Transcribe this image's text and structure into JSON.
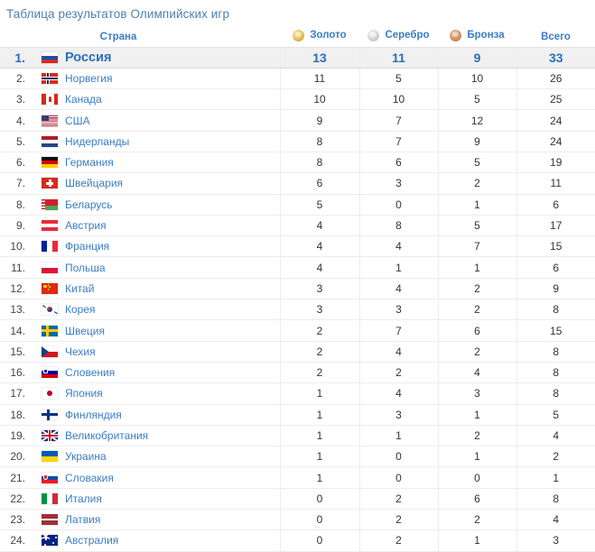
{
  "page": {
    "title": "Таблица результатов Олимпийских игр",
    "accent_color": "#3b7dc4",
    "leader_row_bg": "#f0f0f0"
  },
  "table": {
    "columns": {
      "rank": "",
      "country": "Страна",
      "gold": "Золото",
      "silver": "Серебро",
      "bronze": "Бронза",
      "total": "Всего"
    },
    "icons": {
      "gold": "gold-medal-icon",
      "silver": "silver-medal-icon",
      "bronze": "bronze-medal-icon"
    },
    "rows": [
      {
        "rank": "1.",
        "country": "Россия",
        "flag": "ru",
        "gold": "13",
        "silver": "11",
        "bronze": "9",
        "total": "33",
        "leader": true
      },
      {
        "rank": "2.",
        "country": "Норвегия",
        "flag": "no",
        "gold": "11",
        "silver": "5",
        "bronze": "10",
        "total": "26",
        "leader": false
      },
      {
        "rank": "3.",
        "country": "Канада",
        "flag": "ca",
        "gold": "10",
        "silver": "10",
        "bronze": "5",
        "total": "25",
        "leader": false
      },
      {
        "rank": "4.",
        "country": "США",
        "flag": "us",
        "gold": "9",
        "silver": "7",
        "bronze": "12",
        "total": "24",
        "leader": false
      },
      {
        "rank": "5.",
        "country": "Нидерланды",
        "flag": "nl",
        "gold": "8",
        "silver": "7",
        "bronze": "9",
        "total": "24",
        "leader": false
      },
      {
        "rank": "6.",
        "country": "Германия",
        "flag": "de",
        "gold": "8",
        "silver": "6",
        "bronze": "5",
        "total": "19",
        "leader": false
      },
      {
        "rank": "7.",
        "country": "Швейцария",
        "flag": "ch",
        "gold": "6",
        "silver": "3",
        "bronze": "2",
        "total": "11",
        "leader": false
      },
      {
        "rank": "8.",
        "country": "Беларусь",
        "flag": "by",
        "gold": "5",
        "silver": "0",
        "bronze": "1",
        "total": "6",
        "leader": false
      },
      {
        "rank": "9.",
        "country": "Австрия",
        "flag": "at",
        "gold": "4",
        "silver": "8",
        "bronze": "5",
        "total": "17",
        "leader": false
      },
      {
        "rank": "10.",
        "country": "Франция",
        "flag": "fr",
        "gold": "4",
        "silver": "4",
        "bronze": "7",
        "total": "15",
        "leader": false
      },
      {
        "rank": "11.",
        "country": "Польша",
        "flag": "pl",
        "gold": "4",
        "silver": "1",
        "bronze": "1",
        "total": "6",
        "leader": false
      },
      {
        "rank": "12.",
        "country": "Китай",
        "flag": "cn",
        "gold": "3",
        "silver": "4",
        "bronze": "2",
        "total": "9",
        "leader": false
      },
      {
        "rank": "13.",
        "country": "Корея",
        "flag": "kr",
        "gold": "3",
        "silver": "3",
        "bronze": "2",
        "total": "8",
        "leader": false
      },
      {
        "rank": "14.",
        "country": "Швеция",
        "flag": "se",
        "gold": "2",
        "silver": "7",
        "bronze": "6",
        "total": "15",
        "leader": false
      },
      {
        "rank": "15.",
        "country": "Чехия",
        "flag": "cz",
        "gold": "2",
        "silver": "4",
        "bronze": "2",
        "total": "8",
        "leader": false
      },
      {
        "rank": "16.",
        "country": "Словения",
        "flag": "si",
        "gold": "2",
        "silver": "2",
        "bronze": "4",
        "total": "8",
        "leader": false
      },
      {
        "rank": "17.",
        "country": "Япония",
        "flag": "jp",
        "gold": "1",
        "silver": "4",
        "bronze": "3",
        "total": "8",
        "leader": false
      },
      {
        "rank": "18.",
        "country": "Финляндия",
        "flag": "fi",
        "gold": "1",
        "silver": "3",
        "bronze": "1",
        "total": "5",
        "leader": false
      },
      {
        "rank": "19.",
        "country": "Великобритания",
        "flag": "gb",
        "gold": "1",
        "silver": "1",
        "bronze": "2",
        "total": "4",
        "leader": false
      },
      {
        "rank": "20.",
        "country": "Украина",
        "flag": "ua",
        "gold": "1",
        "silver": "0",
        "bronze": "1",
        "total": "2",
        "leader": false
      },
      {
        "rank": "21.",
        "country": "Словакия",
        "flag": "sk",
        "gold": "1",
        "silver": "0",
        "bronze": "0",
        "total": "1",
        "leader": false
      },
      {
        "rank": "22.",
        "country": "Италия",
        "flag": "it",
        "gold": "0",
        "silver": "2",
        "bronze": "6",
        "total": "8",
        "leader": false
      },
      {
        "rank": "23.",
        "country": "Латвия",
        "flag": "lv",
        "gold": "0",
        "silver": "2",
        "bronze": "2",
        "total": "4",
        "leader": false
      },
      {
        "rank": "24.",
        "country": "Австралия",
        "flag": "au",
        "gold": "0",
        "silver": "2",
        "bronze": "1",
        "total": "3",
        "leader": false
      }
    ]
  }
}
